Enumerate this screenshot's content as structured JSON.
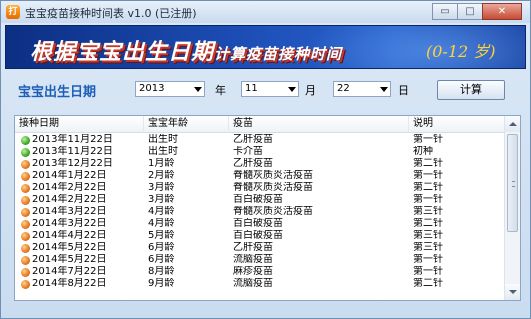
{
  "window": {
    "title": "宝宝疫苗接种时间表 v1.0 (已注册)",
    "icon_glyph": "打",
    "minimize_glyph": "▭",
    "maximize_glyph": "□",
    "close_glyph": "✕"
  },
  "banner": {
    "title_main": "根据宝宝出生日期",
    "title_sub": "计算疫苗接种时间",
    "age_range": "(0-12 岁)"
  },
  "date_form": {
    "label": "宝宝出生日期",
    "year_value": "2013",
    "year_unit": "年",
    "month_value": "11",
    "month_unit": "月",
    "day_value": "22",
    "day_unit": "日",
    "calc_button": "计算"
  },
  "table": {
    "headers": [
      "接种日期",
      "宝宝年龄",
      "疫苗",
      "说明"
    ],
    "rows": [
      {
        "date": "2013年11月22日",
        "age": "出生时",
        "vaccine": "乙肝疫苗",
        "note": "第一针",
        "status": "green"
      },
      {
        "date": "2013年11月22日",
        "age": "出生时",
        "vaccine": "卡介苗",
        "note": "初种",
        "status": "green"
      },
      {
        "date": "2013年12月22日",
        "age": "1月龄",
        "vaccine": "乙肝疫苗",
        "note": "第二针",
        "status": "orange"
      },
      {
        "date": "2014年1月22日",
        "age": "2月龄",
        "vaccine": "脊髓灰质炎活疫苗",
        "note": "第一针",
        "status": "orange"
      },
      {
        "date": "2014年2月22日",
        "age": "3月龄",
        "vaccine": "脊髓灰质炎活疫苗",
        "note": "第二针",
        "status": "orange"
      },
      {
        "date": "2014年2月22日",
        "age": "3月龄",
        "vaccine": "百白破疫苗",
        "note": "第一针",
        "status": "orange"
      },
      {
        "date": "2014年3月22日",
        "age": "4月龄",
        "vaccine": "脊髓灰质炎活疫苗",
        "note": "第三针",
        "status": "orange"
      },
      {
        "date": "2014年3月22日",
        "age": "4月龄",
        "vaccine": "百白破疫苗",
        "note": "第二针",
        "status": "orange"
      },
      {
        "date": "2014年4月22日",
        "age": "5月龄",
        "vaccine": "百白破疫苗",
        "note": "第三针",
        "status": "orange"
      },
      {
        "date": "2014年5月22日",
        "age": "6月龄",
        "vaccine": "乙肝疫苗",
        "note": "第三针",
        "status": "orange"
      },
      {
        "date": "2014年5月22日",
        "age": "6月龄",
        "vaccine": "流脑疫苗",
        "note": "第一针",
        "status": "orange"
      },
      {
        "date": "2014年7月22日",
        "age": "8月龄",
        "vaccine": "麻疹疫苗",
        "note": "第一针",
        "status": "orange"
      },
      {
        "date": "2014年8月22日",
        "age": "9月龄",
        "vaccine": "流脑疫苗",
        "note": "第二针",
        "status": "orange"
      }
    ]
  },
  "colors": {
    "banner_dark": "#0c2f83",
    "label_blue": "#1d5fb8",
    "status_green": "#2d9b17",
    "status_orange": "#e06a10"
  }
}
